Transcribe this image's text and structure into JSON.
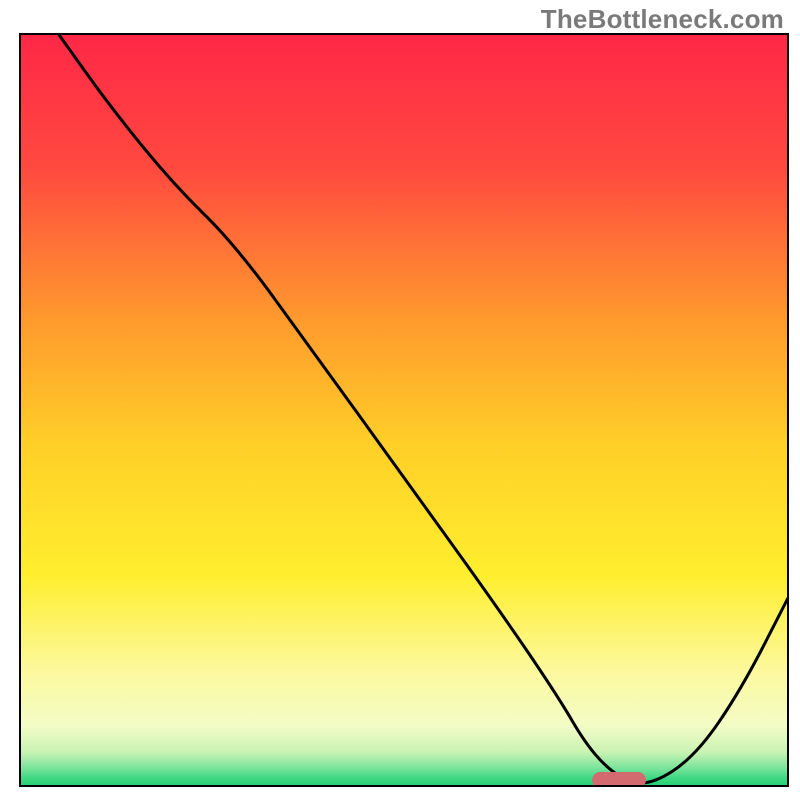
{
  "watermark": "TheBottleneck.com",
  "chart_data": {
    "type": "line",
    "title": "",
    "xlabel": "",
    "ylabel": "",
    "xlim": [
      0,
      100
    ],
    "ylim": [
      0,
      100
    ],
    "grid": false,
    "legend": false,
    "background_gradient_stops": [
      {
        "offset": 0.0,
        "color": "#ff2747"
      },
      {
        "offset": 0.18,
        "color": "#ff4a3f"
      },
      {
        "offset": 0.38,
        "color": "#ff9a2d"
      },
      {
        "offset": 0.55,
        "color": "#ffd028"
      },
      {
        "offset": 0.72,
        "color": "#ffee2e"
      },
      {
        "offset": 0.85,
        "color": "#fcf99f"
      },
      {
        "offset": 0.92,
        "color": "#f3fcc6"
      },
      {
        "offset": 0.955,
        "color": "#c9f3b3"
      },
      {
        "offset": 0.975,
        "color": "#7fe59d"
      },
      {
        "offset": 0.99,
        "color": "#3dd783"
      },
      {
        "offset": 1.0,
        "color": "#23cf71"
      }
    ],
    "series": [
      {
        "name": "bottleneck-curve",
        "x": [
          5,
          12,
          20,
          28,
          38,
          50,
          62,
          70,
          74,
          78,
          82,
          88,
          94,
          100
        ],
        "values": [
          100,
          90,
          80,
          72,
          58,
          41,
          24,
          12,
          5,
          1,
          0,
          4,
          13,
          25
        ]
      }
    ],
    "marker": {
      "name": "optimal-range",
      "x_center": 78,
      "y": 0.8,
      "width_x": 7,
      "color": "#d26a6f"
    }
  }
}
